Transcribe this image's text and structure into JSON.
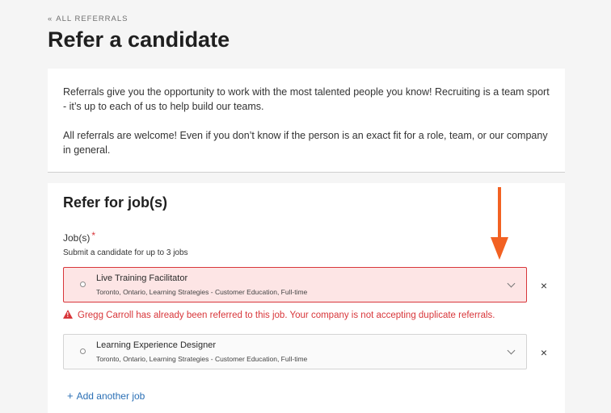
{
  "breadcrumb": {
    "chevron": "«",
    "label": "ALL REFERRALS"
  },
  "page_title": "Refer a candidate",
  "intro": {
    "paragraph1": "Referrals give you the opportunity to work with the most talented people you know! Recruiting is a team sport - it’s up to each of us to help build our teams.",
    "paragraph2": "All referrals are welcome! Even if you don’t know if the person is an exact fit for a role, team, or our company in general."
  },
  "jobs_section": {
    "title": "Refer for job(s)",
    "field_label": "Job(s)",
    "required_mark": "*",
    "hint": "Submit a candidate for up to 3 jobs",
    "jobs": [
      {
        "title": "Live Training Facilitator",
        "meta": "Toronto, Ontario, Learning Strategies - Customer Education, Full-time",
        "state": "error"
      },
      {
        "title": "Learning Experience Designer",
        "meta": "Toronto, Ontario, Learning Strategies - Customer Education, Full-time",
        "state": "normal"
      }
    ],
    "error_message": "Gregg Carroll has already been referred to this job. Your company is not accepting duplicate referrals.",
    "remove_glyph": "×",
    "add_another": {
      "plus": "+",
      "label": "Add another job"
    }
  },
  "colors": {
    "error": "#d8363a",
    "error_bg": "#fde5e5",
    "link": "#2a6fb5",
    "annotation_arrow": "#f26122"
  }
}
